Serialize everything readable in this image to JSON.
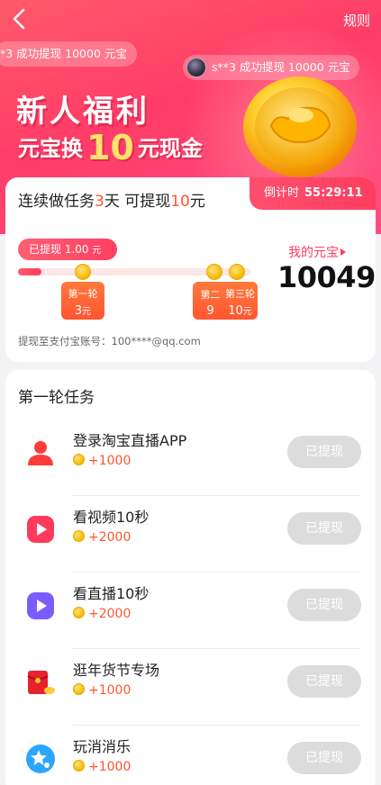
{
  "header": {
    "rules_label": "规则"
  },
  "toasts": [
    {
      "text": "*3 成功提现 10000 元宝"
    },
    {
      "text": "s**3 成功提现 10000 元宝"
    }
  ],
  "hero": {
    "title": "新人福利",
    "subtitle_prefix": "元宝换",
    "subtitle_amount": "10",
    "subtitle_suffix": "元现金"
  },
  "summary": {
    "streak_a": "连续做任务",
    "streak_days": "3",
    "streak_b": "天 可提现",
    "streak_amount": "10",
    "streak_c": "元",
    "countdown_label": "倒计时",
    "countdown_time": "55:29:11",
    "withdrawn_label": "已提现",
    "withdrawn_amount": "1.00",
    "withdrawn_unit": "元",
    "progress": 0.1,
    "stages": [
      {
        "label": "第一轮",
        "amount": "3",
        "unit": "元"
      },
      {
        "label": "第二",
        "amount": "9",
        "unit": ""
      },
      {
        "label": "第三轮",
        "amount": "10",
        "unit": "元"
      }
    ],
    "my_ingots_label": "我的元宝",
    "my_ingots_value": "10049",
    "account_text": "提现至支付宝账号：100****@qq.com"
  },
  "tasks": {
    "title": "第一轮任务",
    "items": [
      {
        "name": "登录淘宝直播APP",
        "reward": "+1000",
        "button": "已提现",
        "icon": "user-icon",
        "color": "#ff3b3b"
      },
      {
        "name": "看视频10秒",
        "reward": "+2000",
        "button": "已提现",
        "icon": "video-play-icon",
        "color": "#ff3a5a"
      },
      {
        "name": "看直播10秒",
        "reward": "+2000",
        "button": "已提现",
        "icon": "live-play-icon",
        "color": "#7b5cff"
      },
      {
        "name": "逛年货节专场",
        "reward": "+1000",
        "button": "已提现",
        "icon": "red-envelope-icon",
        "color": "#e8212b"
      },
      {
        "name": "玩消消乐",
        "reward": "+1000",
        "button": "已提现",
        "icon": "game-star-icon",
        "color": "#2aa6ff"
      }
    ]
  }
}
